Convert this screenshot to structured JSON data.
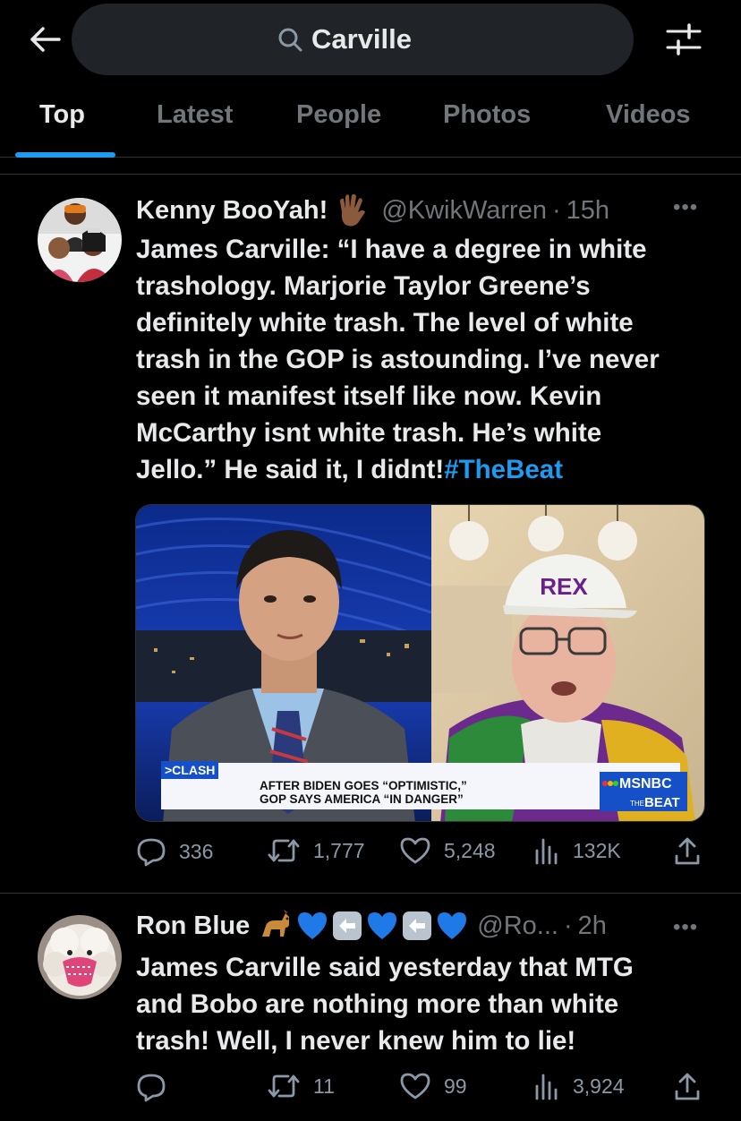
{
  "search": {
    "query": "Carville"
  },
  "tabs": [
    {
      "label": "Top"
    },
    {
      "label": "Latest"
    },
    {
      "label": "People"
    },
    {
      "label": "Photos"
    },
    {
      "label": "Videos"
    }
  ],
  "tweets": [
    {
      "name": "Kenny BooYah!",
      "handle": "@KwikWarren",
      "dot": "·",
      "time": "15h",
      "text_lines": [
        "James Carville: “I have a degree in white",
        "trashology. Marjorie Taylor Greene’s",
        "definitely white trash. The level of white",
        "trash in the GOP is astounding. I’ve never",
        "seen it manifest itself like now. Kevin",
        "McCarthy isnt white trash. He’s white"
      ],
      "last_line": "Jello.” He said it, I didnt!",
      "hashtag": "#TheBeat",
      "media": {
        "chyron_tag": ">CLASH",
        "chyron_line1": "AFTER BIDEN GOES “OPTIMISTIC,”",
        "chyron_line2": "GOP SAYS AMERICA “IN DANGER”",
        "network": "MSNBC",
        "show_prefix": "THE",
        "show": "BEAT",
        "cap_text": "REX"
      },
      "replies": "336",
      "retweets": "1,777",
      "likes": "5,248",
      "views": "132K"
    },
    {
      "name": "Ron Blue",
      "handle": "@Ro...",
      "dot": "·",
      "time": "2h",
      "text_lines": [
        "James Carville said yesterday that MTG",
        "and Bobo are nothing more than white",
        "trash! Well, I never knew him to lie!"
      ],
      "replies": "",
      "retweets": "11",
      "likes": "99",
      "views": "3,924"
    }
  ],
  "colors": {
    "accent": "#1d9bf0",
    "muted": "#71767b",
    "text": "#e7e9ea",
    "background": "#000000"
  }
}
